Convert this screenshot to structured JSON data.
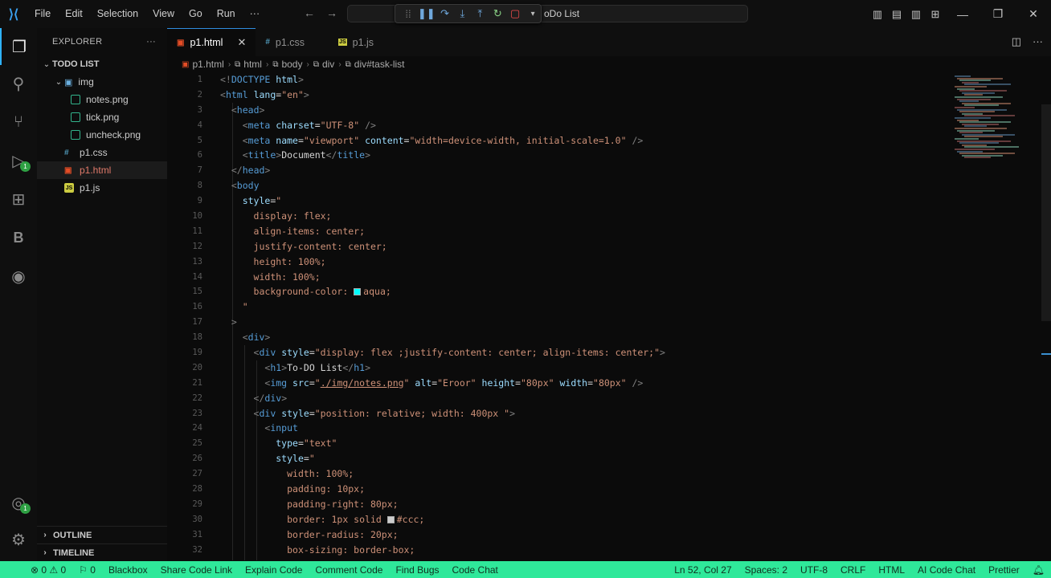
{
  "menu": [
    "File",
    "Edit",
    "Selection",
    "View",
    "Go",
    "Run",
    "···"
  ],
  "command_center_text": "oDo List",
  "explorer": {
    "title": "EXPLORER",
    "more": "···",
    "root": "TODO LIST",
    "items": [
      {
        "label": "img",
        "type": "folder",
        "indent": 1
      },
      {
        "label": "notes.png",
        "type": "png",
        "indent": 2
      },
      {
        "label": "tick.png",
        "type": "png",
        "indent": 2
      },
      {
        "label": "uncheck.png",
        "type": "png",
        "indent": 2
      },
      {
        "label": "p1.css",
        "type": "css",
        "indent": 1
      },
      {
        "label": "p1.html",
        "type": "html",
        "indent": 1,
        "selected": true
      },
      {
        "label": "p1.js",
        "type": "js",
        "indent": 1
      }
    ],
    "outline": "OUTLINE",
    "timeline": "TIMELINE"
  },
  "tabs": [
    {
      "label": "p1.html",
      "active": true
    },
    {
      "label": "p1.css",
      "active": false
    },
    {
      "label": "p1.js",
      "active": false
    }
  ],
  "breadcrumb": [
    "p1.html",
    "html",
    "body",
    "div",
    "div#task-list"
  ],
  "line_numbers": [
    "1",
    "2",
    "3",
    "4",
    "5",
    "6",
    "7",
    "8",
    "9",
    "10",
    "11",
    "12",
    "13",
    "14",
    "15",
    "16",
    "17",
    "18",
    "19",
    "20",
    "21",
    "22",
    "23",
    "24",
    "25",
    "26",
    "27",
    "28",
    "29",
    "30",
    "31",
    "32"
  ],
  "code_lines": [
    [
      [
        "t-punc",
        "<!"
      ],
      [
        "t-tag",
        "DOCTYPE"
      ],
      [
        "t-attr",
        " html"
      ],
      [
        "t-punc",
        ">"
      ]
    ],
    [
      [
        "t-punc",
        "<"
      ],
      [
        "t-tag",
        "html"
      ],
      [
        "t-attr",
        " lang"
      ],
      [
        "t-text",
        "="
      ],
      [
        "t-str",
        "\"en\""
      ],
      [
        "t-punc",
        ">"
      ]
    ],
    [
      [
        "t-text",
        "  "
      ],
      [
        "t-punc",
        "<"
      ],
      [
        "t-tag",
        "head"
      ],
      [
        "t-punc",
        ">"
      ]
    ],
    [
      [
        "t-text",
        "    "
      ],
      [
        "t-punc",
        "<"
      ],
      [
        "t-tag",
        "meta"
      ],
      [
        "t-attr",
        " charset"
      ],
      [
        "t-text",
        "="
      ],
      [
        "t-str",
        "\"UTF-8\""
      ],
      [
        "t-punc",
        " />"
      ]
    ],
    [
      [
        "t-text",
        "    "
      ],
      [
        "t-punc",
        "<"
      ],
      [
        "t-tag",
        "meta"
      ],
      [
        "t-attr",
        " name"
      ],
      [
        "t-text",
        "="
      ],
      [
        "t-str",
        "\"viewport\""
      ],
      [
        "t-attr",
        " content"
      ],
      [
        "t-text",
        "="
      ],
      [
        "t-str",
        "\"width=device-width, initial-scale=1.0\""
      ],
      [
        "t-punc",
        " />"
      ]
    ],
    [
      [
        "t-text",
        "    "
      ],
      [
        "t-punc",
        "<"
      ],
      [
        "t-tag",
        "title"
      ],
      [
        "t-punc",
        ">"
      ],
      [
        "t-text",
        "Document"
      ],
      [
        "t-punc",
        "</"
      ],
      [
        "t-tag",
        "title"
      ],
      [
        "t-punc",
        ">"
      ]
    ],
    [
      [
        "t-text",
        "  "
      ],
      [
        "t-punc",
        "</"
      ],
      [
        "t-tag",
        "head"
      ],
      [
        "t-punc",
        ">"
      ]
    ],
    [
      [
        "t-text",
        "  "
      ],
      [
        "t-punc",
        "<"
      ],
      [
        "t-tag",
        "body"
      ]
    ],
    [
      [
        "t-text",
        "    "
      ],
      [
        "t-attr",
        "style"
      ],
      [
        "t-text",
        "="
      ],
      [
        "t-str",
        "\""
      ]
    ],
    [
      [
        "t-text",
        "      "
      ],
      [
        "t-prop",
        "display: flex;"
      ]
    ],
    [
      [
        "t-text",
        "      "
      ],
      [
        "t-prop",
        "align-items: center;"
      ]
    ],
    [
      [
        "t-text",
        "      "
      ],
      [
        "t-prop",
        "justify-content: center;"
      ]
    ],
    [
      [
        "t-text",
        "      "
      ],
      [
        "t-prop",
        "height: 100%;"
      ]
    ],
    [
      [
        "t-text",
        "      "
      ],
      [
        "t-prop",
        "width: 100%;"
      ]
    ],
    [
      [
        "t-text",
        "      "
      ],
      [
        "t-prop",
        "background-color: "
      ],
      [
        "swatch",
        "#00ffff"
      ],
      [
        "t-prop",
        "aqua;"
      ]
    ],
    [
      [
        "t-text",
        "    "
      ],
      [
        "t-str",
        "\""
      ]
    ],
    [
      [
        "t-text",
        "  "
      ],
      [
        "t-punc",
        ">"
      ]
    ],
    [
      [
        "t-text",
        "    "
      ],
      [
        "t-punc",
        "<"
      ],
      [
        "t-tag",
        "div"
      ],
      [
        "t-punc",
        ">"
      ]
    ],
    [
      [
        "t-text",
        "      "
      ],
      [
        "t-punc",
        "<"
      ],
      [
        "t-tag",
        "div"
      ],
      [
        "t-attr",
        " style"
      ],
      [
        "t-text",
        "="
      ],
      [
        "t-str",
        "\"display: flex ;justify-content: center; align-items: center;\""
      ],
      [
        "t-punc",
        ">"
      ]
    ],
    [
      [
        "t-text",
        "        "
      ],
      [
        "t-punc",
        "<"
      ],
      [
        "t-tag",
        "h1"
      ],
      [
        "t-punc",
        ">"
      ],
      [
        "t-text",
        "To-DO List"
      ],
      [
        "t-punc",
        "</"
      ],
      [
        "t-tag",
        "h1"
      ],
      [
        "t-punc",
        ">"
      ]
    ],
    [
      [
        "t-text",
        "        "
      ],
      [
        "t-punc",
        "<"
      ],
      [
        "t-tag",
        "img"
      ],
      [
        "t-attr",
        " src"
      ],
      [
        "t-text",
        "="
      ],
      [
        "t-str",
        "\""
      ],
      [
        "t-link",
        "./img/notes.png"
      ],
      [
        "t-str",
        "\""
      ],
      [
        "t-attr",
        " alt"
      ],
      [
        "t-text",
        "="
      ],
      [
        "t-str",
        "\"Eroor\""
      ],
      [
        "t-attr",
        " height"
      ],
      [
        "t-text",
        "="
      ],
      [
        "t-str",
        "\"80px\""
      ],
      [
        "t-attr",
        " width"
      ],
      [
        "t-text",
        "="
      ],
      [
        "t-str",
        "\"80px\""
      ],
      [
        "t-punc",
        " />"
      ]
    ],
    [
      [
        "t-text",
        "      "
      ],
      [
        "t-punc",
        "</"
      ],
      [
        "t-tag",
        "div"
      ],
      [
        "t-punc",
        ">"
      ]
    ],
    [
      [
        "t-text",
        "      "
      ],
      [
        "t-punc",
        "<"
      ],
      [
        "t-tag",
        "div"
      ],
      [
        "t-attr",
        " style"
      ],
      [
        "t-text",
        "="
      ],
      [
        "t-str",
        "\"position: relative; width: 400px \""
      ],
      [
        "t-punc",
        ">"
      ]
    ],
    [
      [
        "t-text",
        "        "
      ],
      [
        "t-punc",
        "<"
      ],
      [
        "t-tag",
        "input"
      ]
    ],
    [
      [
        "t-text",
        "          "
      ],
      [
        "t-attr",
        "type"
      ],
      [
        "t-text",
        "="
      ],
      [
        "t-str",
        "\"text\""
      ]
    ],
    [
      [
        "t-text",
        "          "
      ],
      [
        "t-attr",
        "style"
      ],
      [
        "t-text",
        "="
      ],
      [
        "t-str",
        "\""
      ]
    ],
    [
      [
        "t-text",
        "            "
      ],
      [
        "t-prop",
        "width: 100%;"
      ]
    ],
    [
      [
        "t-text",
        "            "
      ],
      [
        "t-prop",
        "padding: 10px;"
      ]
    ],
    [
      [
        "t-text",
        "            "
      ],
      [
        "t-prop",
        "padding-right: 80px;"
      ]
    ],
    [
      [
        "t-text",
        "            "
      ],
      [
        "t-prop",
        "border: 1px solid "
      ],
      [
        "swatch",
        "#cccccc"
      ],
      [
        "t-prop",
        "#ccc;"
      ]
    ],
    [
      [
        "t-text",
        "            "
      ],
      [
        "t-prop",
        "border-radius: 20px;"
      ]
    ],
    [
      [
        "t-text",
        "            "
      ],
      [
        "t-prop",
        "box-sizing: border-box;"
      ]
    ]
  ],
  "status": {
    "left": [
      "⊗ 0 ⚠ 0",
      "⚐ 0",
      "Blackbox",
      "Share Code Link",
      "Explain Code",
      "Comment Code",
      "Find Bugs",
      "Code Chat"
    ],
    "right": [
      "Ln 52, Col 27",
      "Spaces: 2",
      "UTF-8",
      "CRLF",
      "HTML",
      "AI Code Chat",
      "Prettier"
    ]
  },
  "colors": {
    "status_bg": "#2fe89a",
    "accent": "#2fb3ff"
  }
}
